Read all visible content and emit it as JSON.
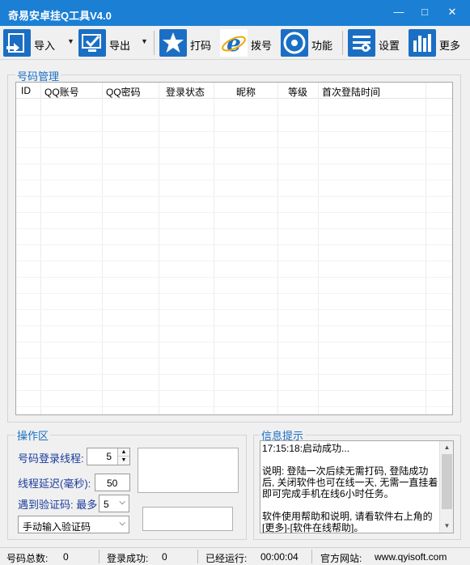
{
  "window": {
    "title": "奇易安卓挂Q工具V4.0",
    "min": "—",
    "max": "□",
    "close": "✕"
  },
  "toolbar": {
    "import": "导入",
    "export": "导出",
    "captcha": "打码",
    "dial": "拨号",
    "features": "功能",
    "settings": "设置",
    "more": "更多",
    "dropdown": "▼"
  },
  "accounts": {
    "title": "号码管理",
    "columns": [
      "ID",
      "QQ账号",
      "QQ密码",
      "登录状态",
      "昵称",
      "等级",
      "首次登陆时间"
    ],
    "rows": []
  },
  "operations": {
    "title": "操作区",
    "login_threads_label": "号码登录线程:",
    "login_threads_value": "5",
    "thread_delay_label": "线程延迟(毫秒):",
    "thread_delay_value": "50",
    "captcha_max_label": "遇到验证码: 最多",
    "captcha_max_value": "5",
    "captcha_mode": "手动输入验证码"
  },
  "info": {
    "title": "信息提示",
    "log": "17:15:18:启动成功...\n\n说明: 登陆一次后续无需打码, 登陆成功后, 关闭软件也可在线一天, 无需一直挂着即可完成手机在线6小时任务。\n\n软件使用帮助和说明, 请看软件右上角的[更多]-[软件在线帮助]。"
  },
  "status": {
    "total_label": "号码总数:",
    "total_value": "0",
    "success_label": "登录成功:",
    "success_value": "0",
    "runtime_label": "已经运行:",
    "runtime_value": "00:00:04",
    "site_label": "官方网站:",
    "site_value": "www.qyisoft.com"
  },
  "colors": {
    "titlebar": "#1b7fd4",
    "accent": "#1a6fc4",
    "label": "#1a3c9c"
  }
}
